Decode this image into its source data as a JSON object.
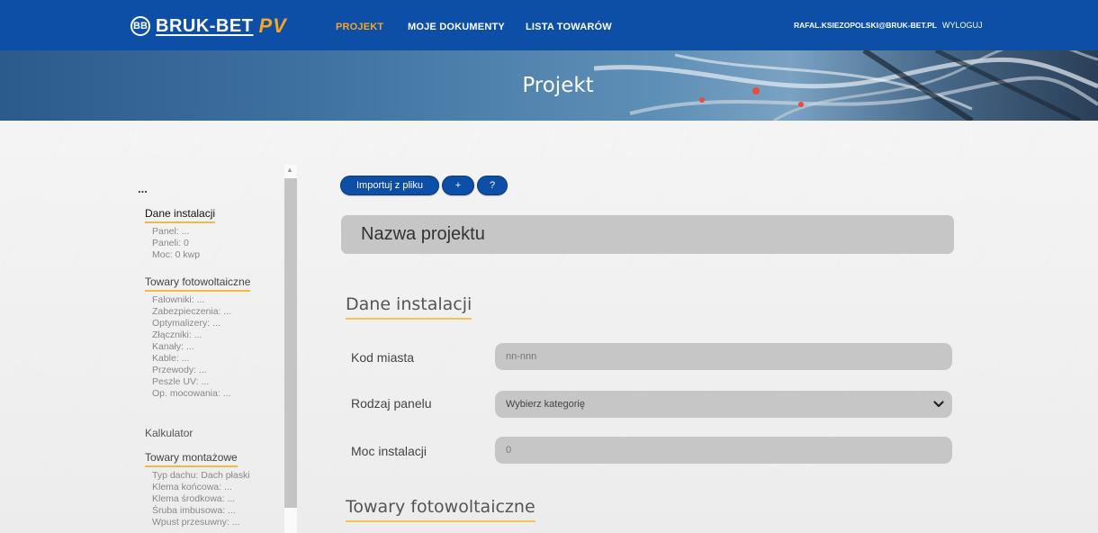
{
  "brand": {
    "name": "BRUK-BET",
    "suffix": "PV",
    "mark": "BB"
  },
  "nav": {
    "items": [
      {
        "label": "PROJEKT"
      },
      {
        "label": "MOJE DOKUMENTY"
      },
      {
        "label": "LISTA TOWARÓW"
      }
    ],
    "user": "RAFAL.KSIEZOPOLSKI@BRUK-BET.PL",
    "logout": "WYLOGUJ"
  },
  "hero": {
    "title": "Projekt"
  },
  "sidebar": {
    "dots": "...",
    "dane": {
      "title": "Dane instalacji",
      "items": [
        "Panel: ...",
        "Paneli: 0",
        "Moc: 0 kwp"
      ]
    },
    "towary": {
      "title": "Towary fotowoltaiczne",
      "items": [
        "Falowniki: ...",
        "Zabezpieczenia: ...",
        "Optymalizery: ...",
        "Złączniki: ...",
        "Kanały: ...",
        "Kable: ...",
        "Przewody: ...",
        "Peszle UV: ...",
        "Op. mocowania: ..."
      ]
    },
    "kalkulator": "Kalkulator",
    "montazowe": {
      "title": "Towary montażowe",
      "items": [
        "Typ dachu: Dach płaski",
        "Klema końcowa: ...",
        "Klema środkowa: ...",
        "Śruba imbusowa: ...",
        "Wpust przesuwny: ..."
      ]
    }
  },
  "toolbar": {
    "import_label": "Importuj z pliku",
    "add_label": "+",
    "help_label": "?"
  },
  "project": {
    "name_placeholder": "Nazwa projektu"
  },
  "sections": {
    "dane": "Dane instalacji",
    "towary": "Towary fotowoltaiczne"
  },
  "form": {
    "kod": {
      "label": "Kod miasta",
      "placeholder": "nn-nnn"
    },
    "panel": {
      "label": "Rodzaj panelu",
      "value": "Wybierz kategorię"
    },
    "moc": {
      "label": "Moc instalacji",
      "placeholder": "0"
    }
  },
  "colors": {
    "primary": "#0d4ea6",
    "accent": "#f5a623",
    "underline": "#f5b942",
    "field": "#c6c6c6"
  }
}
